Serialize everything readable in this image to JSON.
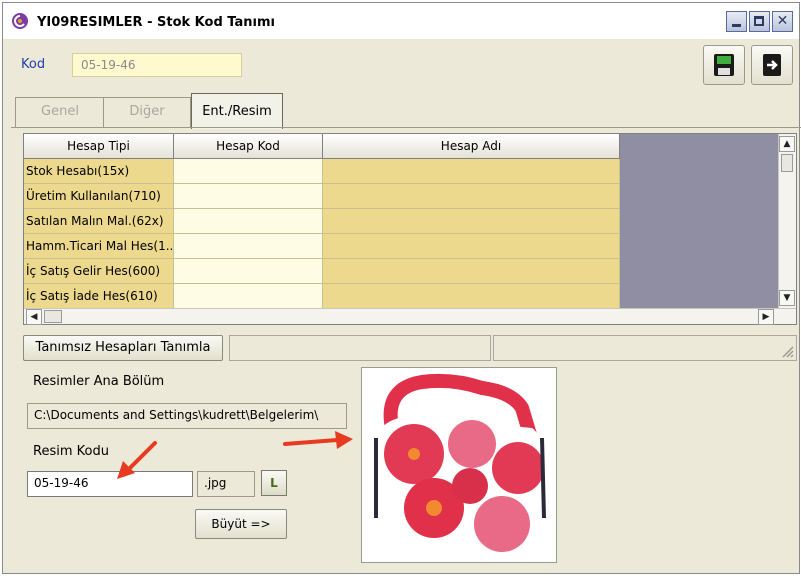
{
  "window": {
    "title": "YI09RESIMLER - Stok Kod Tanımı"
  },
  "kod": {
    "label": "Kod",
    "value": "05-19-46"
  },
  "tabs": [
    {
      "label": "Genel",
      "active": false
    },
    {
      "label": "Diğer",
      "active": false
    },
    {
      "label": "Ent./Resim",
      "active": true
    }
  ],
  "grid": {
    "columns": [
      "Hesap Tipi",
      "Hesap Kod",
      "Hesap Adı"
    ],
    "rows": [
      {
        "tip": "Stok Hesabı(15x)",
        "kod": "",
        "adi": ""
      },
      {
        "tip": "Üretim Kullanılan(710)",
        "kod": "",
        "adi": ""
      },
      {
        "tip": "Satılan Malın Mal.(62x)",
        "kod": "",
        "adi": ""
      },
      {
        "tip": "Hamm.Ticari Mal Hes(1...",
        "kod": "",
        "adi": ""
      },
      {
        "tip": "İç Satış Gelir Hes(600)",
        "kod": "",
        "adi": ""
      },
      {
        "tip": "İç Satış İade Hes(610)",
        "kod": "",
        "adi": ""
      }
    ]
  },
  "buttons": {
    "tanimsiz": "Tanımsız Hesapları Tanımla",
    "buyut": "Büyüt =>",
    "l": "L"
  },
  "resimler": {
    "label": "Resimler Ana Bölüm",
    "path": "C:\\Documents and Settings\\kudrett\\Belgelerim\\"
  },
  "resim_kodu": {
    "label": "Resim Kodu",
    "value": "05-19-46",
    "ext": ".jpg"
  },
  "colors": {
    "grid_yellow": "#ecd98d",
    "grid_light": "#fffce6",
    "grid_empty": "#8f8ea3",
    "arrow_red": "#e83a20",
    "kod_label": "#1e3ea8"
  },
  "icons": {
    "app": "app-logo-icon",
    "save": "floppy-disk-icon",
    "exit": "exit-door-icon"
  }
}
